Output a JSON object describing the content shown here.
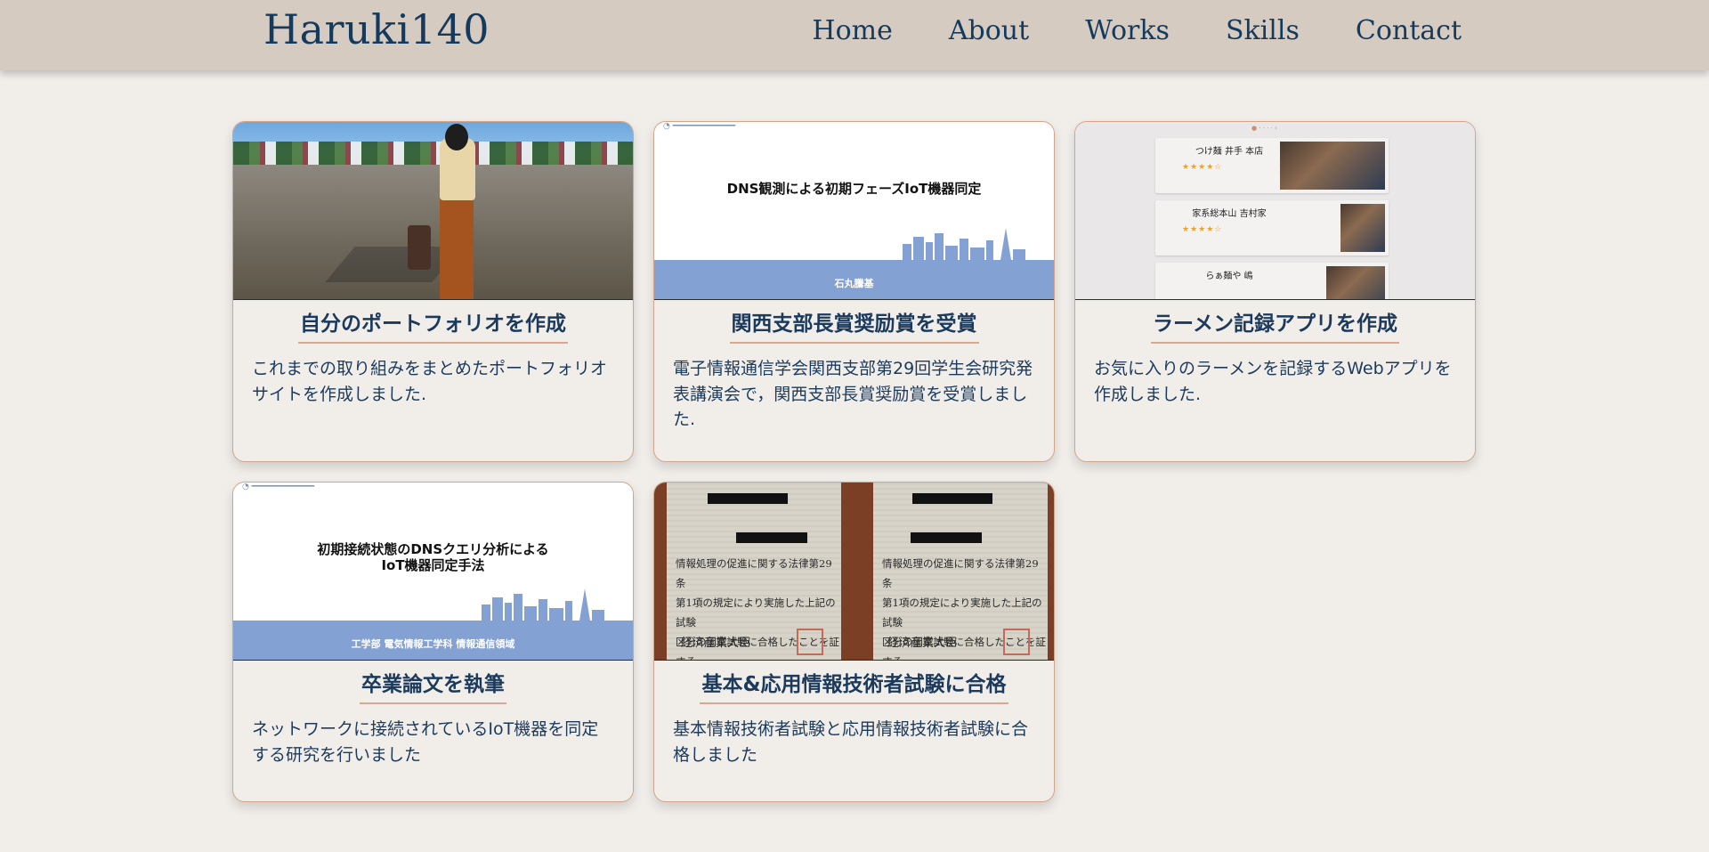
{
  "header": {
    "brand": "Haruki140",
    "nav": [
      "Home",
      "About",
      "Works",
      "Skills",
      "Contact"
    ]
  },
  "works": [
    {
      "title": "自分のポートフォリオを作成",
      "description": "これまでの取り組みをまとめたポートフォリオサイトを作成しました.",
      "thumbnail": "beach-photo"
    },
    {
      "title": "関西支部長賞奨励賞を受賞",
      "description": "電子情報通信学会関西支部第29回学生会研究発表講演会で，関西支部長賞奨励賞を受賞しました.",
      "thumbnail": "slide",
      "slide": {
        "title": "DNS観測による初期フェーズIoT機器同定",
        "author": "石丸騰基"
      }
    },
    {
      "title": "ラーメン記録アプリを作成",
      "description": "お気に入りのラーメンを記録するWebアプリを作成しました.",
      "thumbnail": "app-screenshot",
      "app": {
        "shops": [
          "つけ麺 井手 本店",
          "家系総本山 吉村家",
          "らぁ麺や 嶋"
        ]
      }
    },
    {
      "title": "卒業論文を執筆",
      "description": "ネットワークに接続されているIoT機器を同定する研究を行いました",
      "thumbnail": "slide",
      "slide": {
        "title_line1": "初期接続状態のDNSクエリ分析による",
        "title_line2": "IoT機器同定手法",
        "author": "工学部 電気情報工学科 情報通信領域"
      }
    },
    {
      "title": "基本&応用情報技術者試験に合格",
      "description": "基本情報技術者試験と応用情報技術者試験に合格しました",
      "thumbnail": "certificate-photo",
      "cert": {
        "body": [
          "情報処理の促進に関する法律第29条",
          "第1項の規定により実施した上記の試験",
          "区分の国家試験に合格したことを証する"
        ],
        "issuer": "経済産業大臣"
      }
    }
  ],
  "colors": {
    "header_bg": "#d6cbc0",
    "page_bg": "#f1eeea",
    "text_navy": "#1b3a5c",
    "card_border": "#d2a48c",
    "slide_band": "#84a1d3"
  }
}
